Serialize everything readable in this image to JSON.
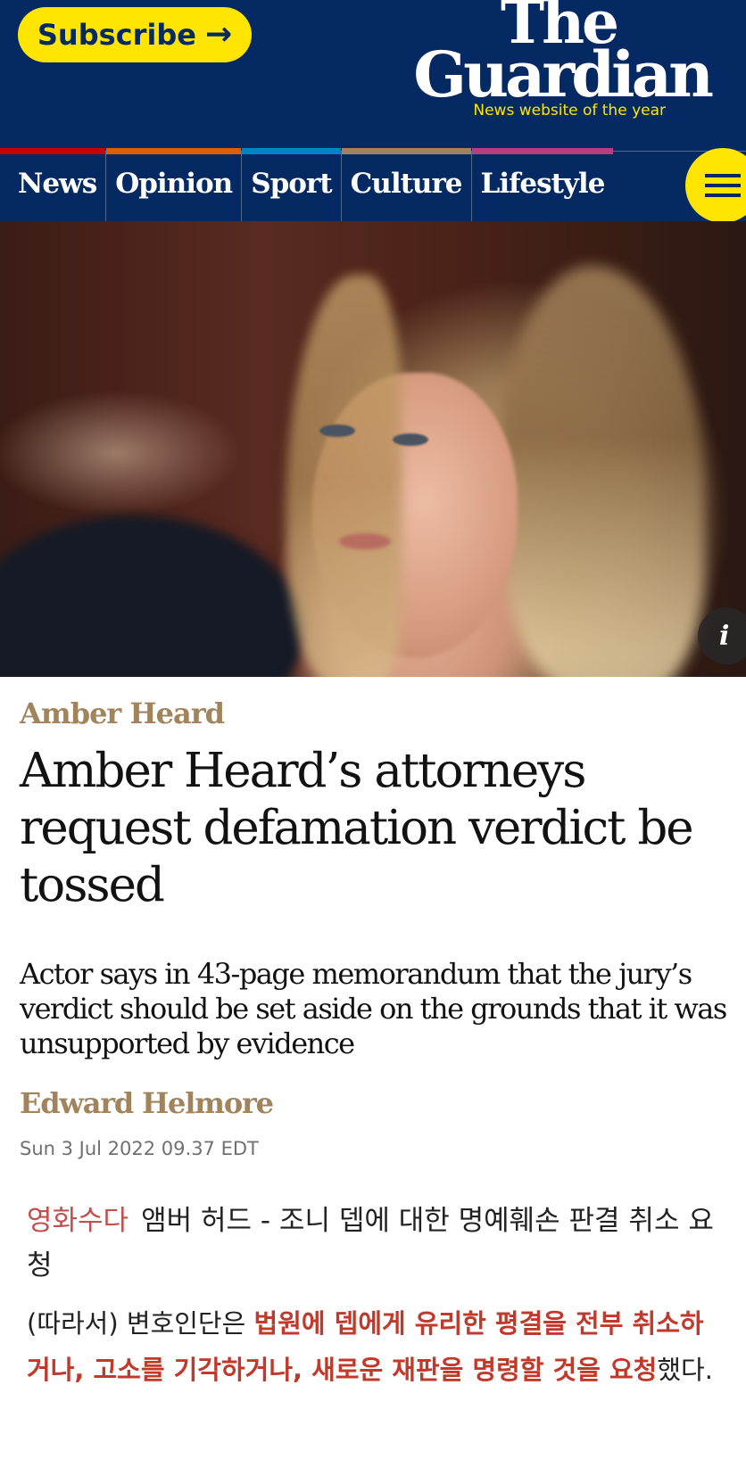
{
  "header": {
    "subscribe_label": "Subscribe",
    "subscribe_arrow": "→",
    "logo_the": "The",
    "logo_guardian": "Guardian",
    "tagline": "News website of the year",
    "colors": {
      "brand": "#052962",
      "accent": "#ffe500"
    }
  },
  "nav": {
    "items": [
      {
        "label": "News",
        "color": "#c70000"
      },
      {
        "label": "Opinion",
        "color": "#e05e00"
      },
      {
        "label": "Sport",
        "color": "#0084c6"
      },
      {
        "label": "Culture",
        "color": "#a1845c"
      },
      {
        "label": "Lifestyle",
        "color": "#bb3b80"
      }
    ],
    "menu_icon": "hamburger-icon"
  },
  "hero": {
    "info_label": "i",
    "info_icon": "info-icon"
  },
  "article": {
    "kicker": "Amber Heard",
    "headline": "Amber Heard’s attorneys request defamation verdict be tossed",
    "standfirst": "Actor says in 43-page memorandum that the jury’s verdict should be set aside on the grounds that it was unsupported by evidence",
    "byline": "Edward Helmore",
    "date": "Sun 3 Jul 2022 09.37 EDT"
  },
  "korean": {
    "tag": "영화수다",
    "title": "앰버 허드 - 조니 뎁에 대한 명예훼손 판결 취소 요청",
    "body_prefix": "(따라서) 변호인단은 ",
    "body_highlight": "법원에 뎁에게 유리한 평결을 전부 취소하거나, 고소를 기각하거나, 새로운 재판을 명령할 것을 요청",
    "body_suffix": "했다."
  }
}
